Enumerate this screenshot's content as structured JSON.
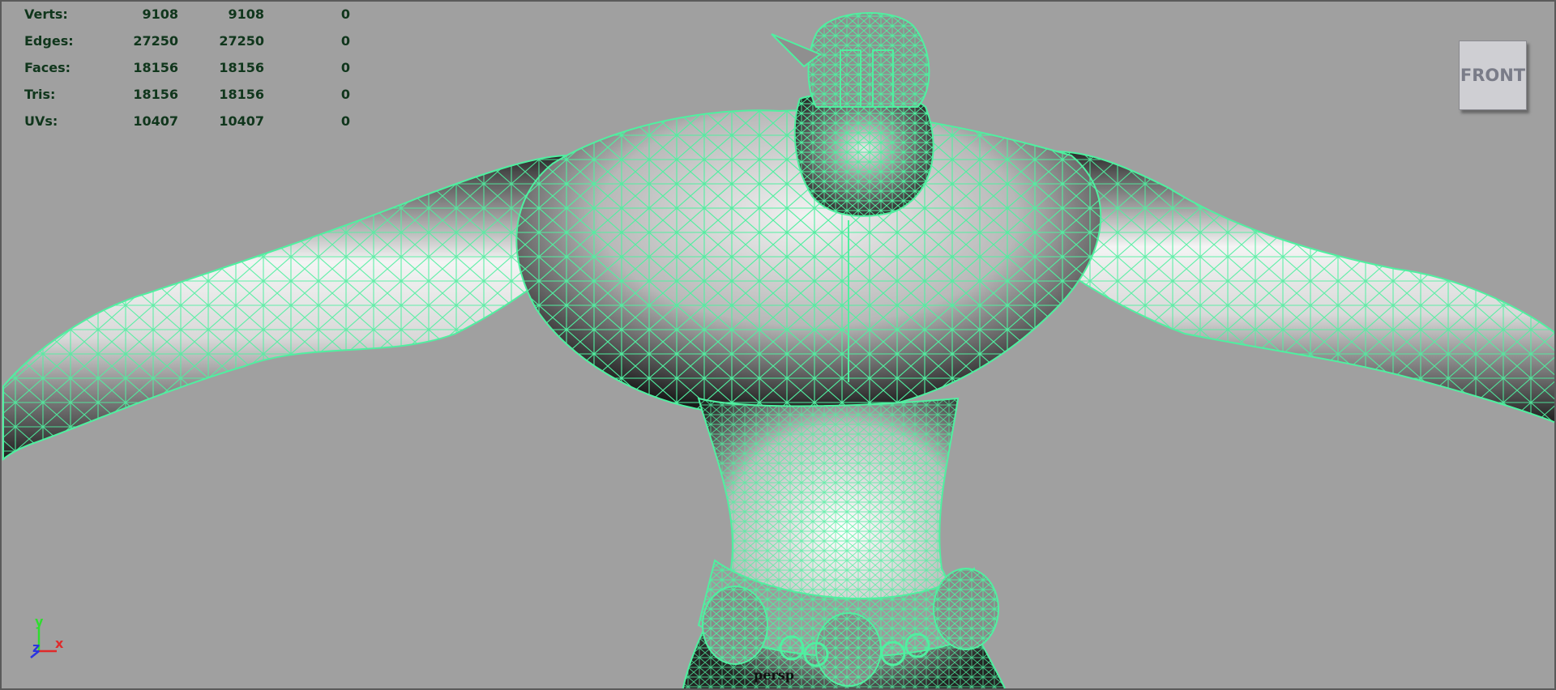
{
  "hud": {
    "rows": [
      {
        "label": "Verts:",
        "values": [
          "9108",
          "9108",
          "0"
        ]
      },
      {
        "label": "Edges:",
        "values": [
          "27250",
          "27250",
          "0"
        ]
      },
      {
        "label": "Faces:",
        "values": [
          "18156",
          "18156",
          "0"
        ]
      },
      {
        "label": "Tris:",
        "values": [
          "18156",
          "18156",
          "0"
        ]
      },
      {
        "label": "UVs:",
        "values": [
          "10407",
          "10407",
          "0"
        ]
      }
    ]
  },
  "viewcube": {
    "label": "FRONT"
  },
  "axis": {
    "y_label": "y",
    "z_label": "z",
    "x_label": "x"
  },
  "camera_label": "persp",
  "colors": {
    "viewport_bg": "#a0a0a0",
    "wireframe": "#4ff0a0",
    "hud_text": "#10361c",
    "axis_y": "#2fdc2f",
    "axis_z": "#2a34e0",
    "axis_x": "#e02a2a"
  }
}
